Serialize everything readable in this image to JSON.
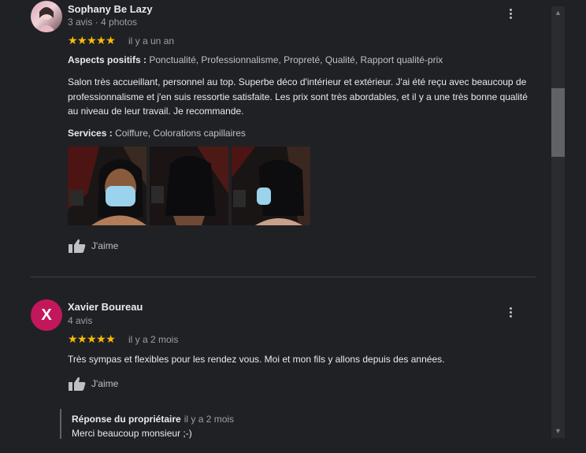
{
  "reviews": [
    {
      "author": "Sophany Be Lazy",
      "meta": "3 avis · 4 photos",
      "stars": "★★★★★",
      "rating": 5,
      "when": "il y a un an",
      "aspects_label": "Aspects positifs :",
      "aspects_value": "Ponctualité, Professionnalisme, Propreté, Qualité, Rapport qualité-prix",
      "text": "Salon très accueillant, personnel au top. Superbe déco d'intérieur et extérieur. J'ai été reçu avec beaucoup de professionnalisme et j'en suis ressortie satisfaite. Les prix sont très abordables, et il y a une très bonne qualité au niveau de leur travail. Je recommande.",
      "services_label": "Services :",
      "services_value": "Coiffure, Colorations capillaires",
      "like_label": "J'aime"
    },
    {
      "author": "Xavier Boureau",
      "avatar_letter": "X",
      "avatar_color": "#c2185b",
      "meta": "4 avis",
      "stars": "★★★★★",
      "rating": 5,
      "when": "il y a 2 mois",
      "text": "Très sympas et flexibles pour les rendez vous. Moi et mon fils y allons depuis des années.",
      "like_label": "J'aime",
      "owner_reply": {
        "title": "Réponse du propriétaire",
        "when": "il y a 2 mois",
        "text": "Merci beaucoup monsieur ;-)"
      }
    }
  ],
  "colors": {
    "background": "#202124",
    "stars": "#fbbc04",
    "text": "#e8eaed",
    "secondary_text": "#9aa0a6"
  },
  "icons": [
    "more-vert-icon",
    "thumb-up-icon",
    "scroll-up-arrow-icon",
    "scroll-down-arrow-icon"
  ]
}
